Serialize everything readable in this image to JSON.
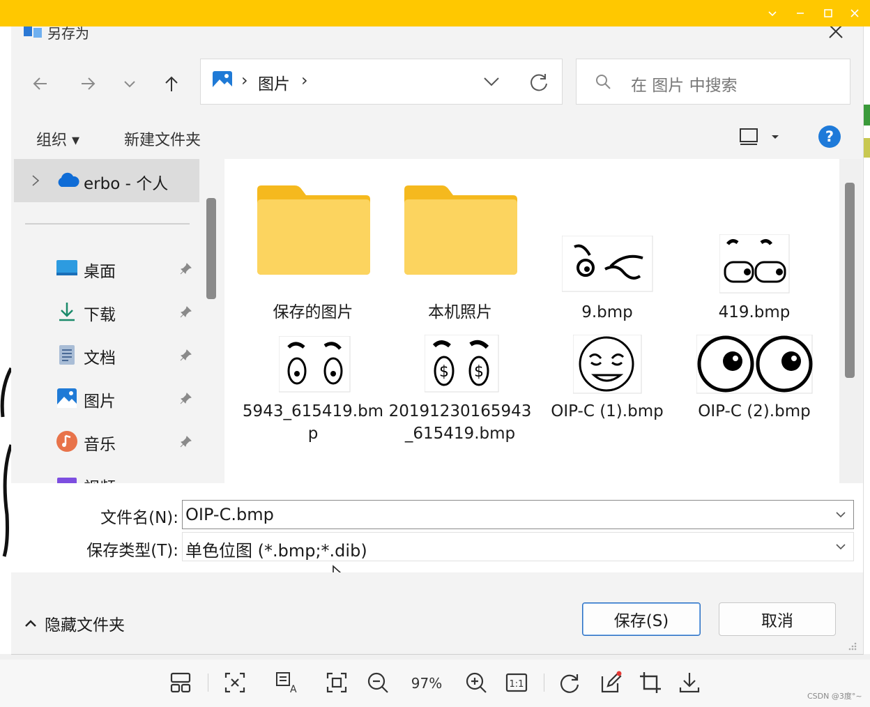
{
  "viewer": {
    "title_buttons": [
      "chevron-down-icon",
      "minimize-icon",
      "maximize-icon",
      "close-icon"
    ],
    "accent": "#ffc800",
    "zoom": "97%",
    "watermark": "CSDN @3度°~",
    "toolbar_icons": [
      "layout-icon",
      "fit-selection-icon",
      "ocr-icon",
      "fullscreen-icon",
      "zoom-out-icon",
      "zoom-in-icon",
      "actual-size-icon",
      "rotate-icon",
      "edit-icon",
      "crop-icon",
      "download-icon"
    ]
  },
  "dialog": {
    "title": "另存为",
    "nav": {
      "back_icon": "arrow-left-icon",
      "forward_icon": "arrow-right-icon",
      "recent_icon": "chevron-down-icon",
      "up_icon": "arrow-up-icon"
    },
    "address": {
      "segment": "图片",
      "sep": "›",
      "icon": "pictures-icon"
    },
    "search": {
      "placeholder": "在 图片 中搜索"
    },
    "commands": {
      "organize": "组织 ▾",
      "new_folder": "新建文件夹",
      "view_icon": "view-icon",
      "help_label": "?"
    },
    "nav_pane": {
      "cloud": "erbo - 个人",
      "items": [
        {
          "label": "桌面",
          "icon": "desktop-icon"
        },
        {
          "label": "下载",
          "icon": "download-icon"
        },
        {
          "label": "文档",
          "icon": "document-icon"
        },
        {
          "label": "图片",
          "icon": "pictures-icon"
        },
        {
          "label": "音乐",
          "icon": "music-icon"
        },
        {
          "label": "视频",
          "icon": "video-icon"
        }
      ]
    },
    "files": [
      {
        "name": "保存的图片",
        "type": "folder"
      },
      {
        "name": "本机照片",
        "type": "folder"
      },
      {
        "name": "9.bmp",
        "type": "image"
      },
      {
        "name": "419.bmp",
        "type": "image"
      },
      {
        "name": "5943_615419.bmp",
        "type": "image"
      },
      {
        "name": "20191230165943_615419.bmp",
        "type": "image"
      },
      {
        "name": "OIP-C (1).bmp",
        "type": "image"
      },
      {
        "name": "OIP-C (2).bmp",
        "type": "image"
      }
    ],
    "filename_label": "文件名(N):",
    "filename_value": "OIP-C.bmp",
    "filetype_label": "保存类型(T):",
    "filetype_value": "单色位图 (*.bmp;*.dib)",
    "hide_folders": "隐藏文件夹",
    "save_button": "保存(S)",
    "cancel_button": "取消"
  }
}
